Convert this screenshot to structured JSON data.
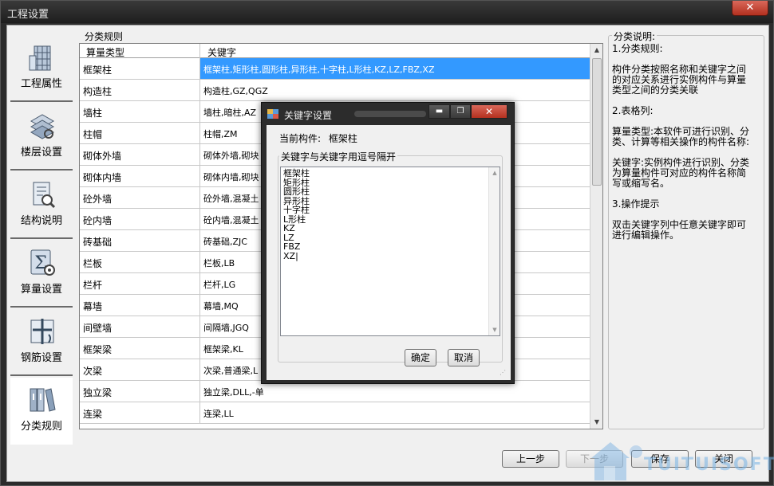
{
  "window": {
    "title": "工程设置",
    "close_glyph": "✕"
  },
  "nav": [
    {
      "label": "工程属性",
      "icon": "building-icon"
    },
    {
      "label": "楼层设置",
      "icon": "floor-layers-icon"
    },
    {
      "label": "结构说明",
      "icon": "document-search-icon"
    },
    {
      "label": "算量设置",
      "icon": "sigma-gear-icon"
    },
    {
      "label": "钢筋设置",
      "icon": "rebar-icon"
    },
    {
      "label": "分类规则",
      "icon": "binders-icon"
    }
  ],
  "rules": {
    "group_label": "分类规则",
    "headers": {
      "type": "算量类型",
      "keywords": "关键字"
    },
    "rows": [
      {
        "type": "框架柱",
        "keywords": "框架柱,矩形柱,圆形柱,异形柱,十字柱,L形柱,KZ,LZ,FBZ,XZ"
      },
      {
        "type": "构造柱",
        "keywords": "构造柱,GZ,QGZ"
      },
      {
        "type": "墙柱",
        "keywords": "墙柱,暗柱,AZ"
      },
      {
        "type": "柱帽",
        "keywords": "柱帽,ZM"
      },
      {
        "type": "砌体外墙",
        "keywords": "砌体外墙,砌块"
      },
      {
        "type": "砌体内墙",
        "keywords": "砌体内墙,砌块"
      },
      {
        "type": "砼外墙",
        "keywords": "砼外墙,混凝土"
      },
      {
        "type": "砼内墙",
        "keywords": "砼内墙,混凝土"
      },
      {
        "type": "砖基础",
        "keywords": "砖基础,ZJC"
      },
      {
        "type": "栏板",
        "keywords": "栏板,LB"
      },
      {
        "type": "栏杆",
        "keywords": "栏杆,LG"
      },
      {
        "type": "幕墙",
        "keywords": "幕墙,MQ"
      },
      {
        "type": "间壁墙",
        "keywords": "间隔墙,JGQ"
      },
      {
        "type": "框架梁",
        "keywords": "框架梁,KL"
      },
      {
        "type": "次梁",
        "keywords": "次梁,普通梁,L"
      },
      {
        "type": "独立梁",
        "keywords": "独立梁,DLL,-单"
      },
      {
        "type": "连梁",
        "keywords": "连梁,LL"
      }
    ],
    "selected_index": 0
  },
  "description": {
    "group_label": "分类说明:",
    "paragraphs": [
      "1.分类规则:",
      "构件分类按照名称和关键字之间的对应关系进行实例构件与算量类型之间的分类关联",
      "2.表格列:",
      "算量类型:本软件可进行识别、分类、计算等相关操作的构件名称:",
      "关键字:实例构件进行识别、分类为算量构件可对应的构件名称简写或缩写名。",
      "3.操作提示",
      "双击关键字列中任意关键字即可进行编辑操作。"
    ]
  },
  "buttons": {
    "prev": "上一步",
    "next": "下一步",
    "save": "保存",
    "close": "关闭"
  },
  "watermark": "TUITUISOFT",
  "dialog": {
    "title": "关键字设置",
    "current_label": "当前构件:",
    "current_value": "框架柱",
    "group_label": "关键字与关键字用逗号隔开",
    "keywords_text": "框架柱\n矩形柱\n圆形柱\n异形柱\n十字柱\nL形柱\nKZ\nLZ\nFBZ\nXZ|",
    "ok": "确定",
    "cancel": "取消",
    "min_glyph": "▬",
    "max_glyph": "❐",
    "close_glyph": "✕"
  }
}
